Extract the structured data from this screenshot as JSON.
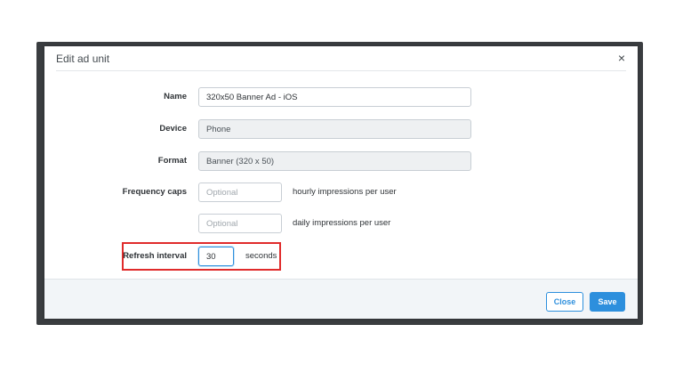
{
  "modal": {
    "title": "Edit ad unit",
    "close_glyph": "×"
  },
  "form": {
    "name": {
      "label": "Name",
      "value": "320x50 Banner Ad - iOS"
    },
    "device": {
      "label": "Device",
      "value": "Phone"
    },
    "format": {
      "label": "Format",
      "value": "Banner (320 x 50)"
    },
    "frequency_caps": {
      "label": "Frequency caps",
      "hourly": {
        "placeholder": "Optional",
        "suffix": "hourly impressions per user"
      },
      "daily": {
        "placeholder": "Optional",
        "suffix": "daily impressions per user"
      }
    },
    "refresh_interval": {
      "label": "Refresh interval",
      "value": "30",
      "suffix": "seconds"
    }
  },
  "footer": {
    "close_label": "Close",
    "save_label": "Save"
  },
  "colors": {
    "accent": "#2d8fdd",
    "highlight": "#e02b2b"
  }
}
